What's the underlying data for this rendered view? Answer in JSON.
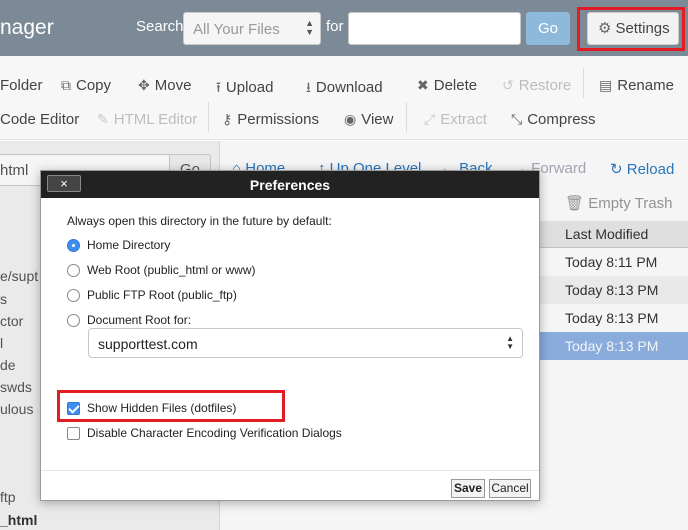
{
  "header": {
    "app_title": "nager",
    "search_label": "Search",
    "search_scope": "All Your Files",
    "for_label": "for",
    "search_query": "",
    "go_label": "Go",
    "settings_label": "Settings"
  },
  "toolbar": {
    "row1": {
      "folder": "Folder",
      "copy": "Copy",
      "move": "Move",
      "upload": "Upload",
      "download": "Download",
      "delete": "Delete",
      "restore": "Restore",
      "rename": "Rename"
    },
    "row2": {
      "code_editor": "Code Editor",
      "html_editor": "HTML Editor",
      "permissions": "Permissions",
      "view": "View",
      "extract": "Extract",
      "compress": "Compress"
    }
  },
  "left_panel": {
    "path_value": "html",
    "go_label": "Go",
    "tree": [
      "e/supt",
      "s",
      "ctor",
      "l",
      "de",
      "swds",
      "ulous",
      "ftp",
      "_html"
    ]
  },
  "nav": {
    "home": "Home",
    "up_one_level": "Up One Level",
    "back": "Back",
    "forward": "Forward",
    "reload": "Reload",
    "empty_trash": "Empty Trash"
  },
  "file_table": {
    "column": "Last Modified",
    "rows": [
      "Today 8:11 PM",
      "Today 8:13 PM",
      "Today 8:13 PM",
      "Today 8:13 PM"
    ],
    "selected_index": 3
  },
  "preferences": {
    "title": "Preferences",
    "close_label": "×",
    "intro": "Always open this directory in the future by default:",
    "radio_options": [
      "Home Directory",
      "Web Root (public_html or www)",
      "Public FTP Root (public_ftp)",
      "Document Root for:"
    ],
    "selected_radio": 0,
    "document_root_domain": "supporttest.com",
    "show_hidden_label": "Show Hidden Files (dotfiles)",
    "show_hidden_checked": true,
    "disable_encoding_label": "Disable Character Encoding Verification Dialogs",
    "disable_encoding_checked": false,
    "save_label": "Save",
    "cancel_label": "Cancel"
  },
  "colors": {
    "header_bg": "#7b8a96",
    "highlight_red": "#e31b23",
    "link_blue": "#2c7bc4",
    "selected_row": "#8fb3e6"
  }
}
